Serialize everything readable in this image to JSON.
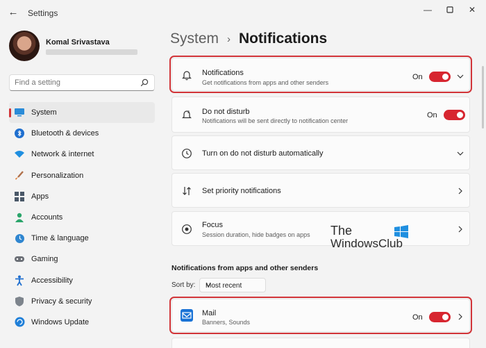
{
  "window": {
    "title": "Settings",
    "back_icon": "arrow-left-icon",
    "controls": [
      "minimize-icon",
      "maximize-icon",
      "close-icon"
    ]
  },
  "user": {
    "name": "Komal Srivastava"
  },
  "search": {
    "placeholder": "Find a setting"
  },
  "sidebar": {
    "items": [
      {
        "label": "System",
        "icon": "monitor-icon",
        "selected": true
      },
      {
        "label": "Bluetooth & devices",
        "icon": "bluetooth-icon"
      },
      {
        "label": "Network & internet",
        "icon": "wifi-icon"
      },
      {
        "label": "Personalization",
        "icon": "brush-icon"
      },
      {
        "label": "Apps",
        "icon": "apps-icon"
      },
      {
        "label": "Accounts",
        "icon": "person-icon"
      },
      {
        "label": "Time & language",
        "icon": "clock-globe-icon"
      },
      {
        "label": "Gaming",
        "icon": "gamepad-icon"
      },
      {
        "label": "Accessibility",
        "icon": "accessibility-icon"
      },
      {
        "label": "Privacy & security",
        "icon": "shield-icon"
      },
      {
        "label": "Windows Update",
        "icon": "update-icon"
      }
    ]
  },
  "breadcrumb": {
    "parent": "System",
    "separator": "›",
    "current": "Notifications"
  },
  "cards": [
    {
      "title": "Notifications",
      "subtitle": "Get notifications from apps and other senders",
      "state": "On",
      "toggle_on": true,
      "icon": "bell-icon",
      "highlighted": true
    },
    {
      "title": "Do not disturb",
      "subtitle": "Notifications will be sent directly to notification center",
      "state": "On",
      "toggle_on": true,
      "icon": "bell-snooze-icon"
    },
    {
      "title": "Turn on do not disturb automatically",
      "icon": "clock-icon"
    },
    {
      "title": "Set priority notifications",
      "icon": "sort-icon"
    },
    {
      "title": "Focus",
      "subtitle": "Session duration, hide badges on apps",
      "icon": "focus-icon"
    }
  ],
  "apps_section": {
    "title": "Notifications from apps and other senders",
    "sort_label": "Sort by:",
    "sort_value": "Most recent",
    "apps": [
      {
        "title": "Mail",
        "subtitle": "Banners, Sounds",
        "state": "On",
        "toggle_on": true,
        "icon": "mail-icon",
        "highlighted": true
      }
    ]
  },
  "watermark": {
    "line1": "The",
    "line2": "WindowsClub"
  },
  "colors": {
    "accent": "#d72630",
    "highlight": "#d13438"
  }
}
